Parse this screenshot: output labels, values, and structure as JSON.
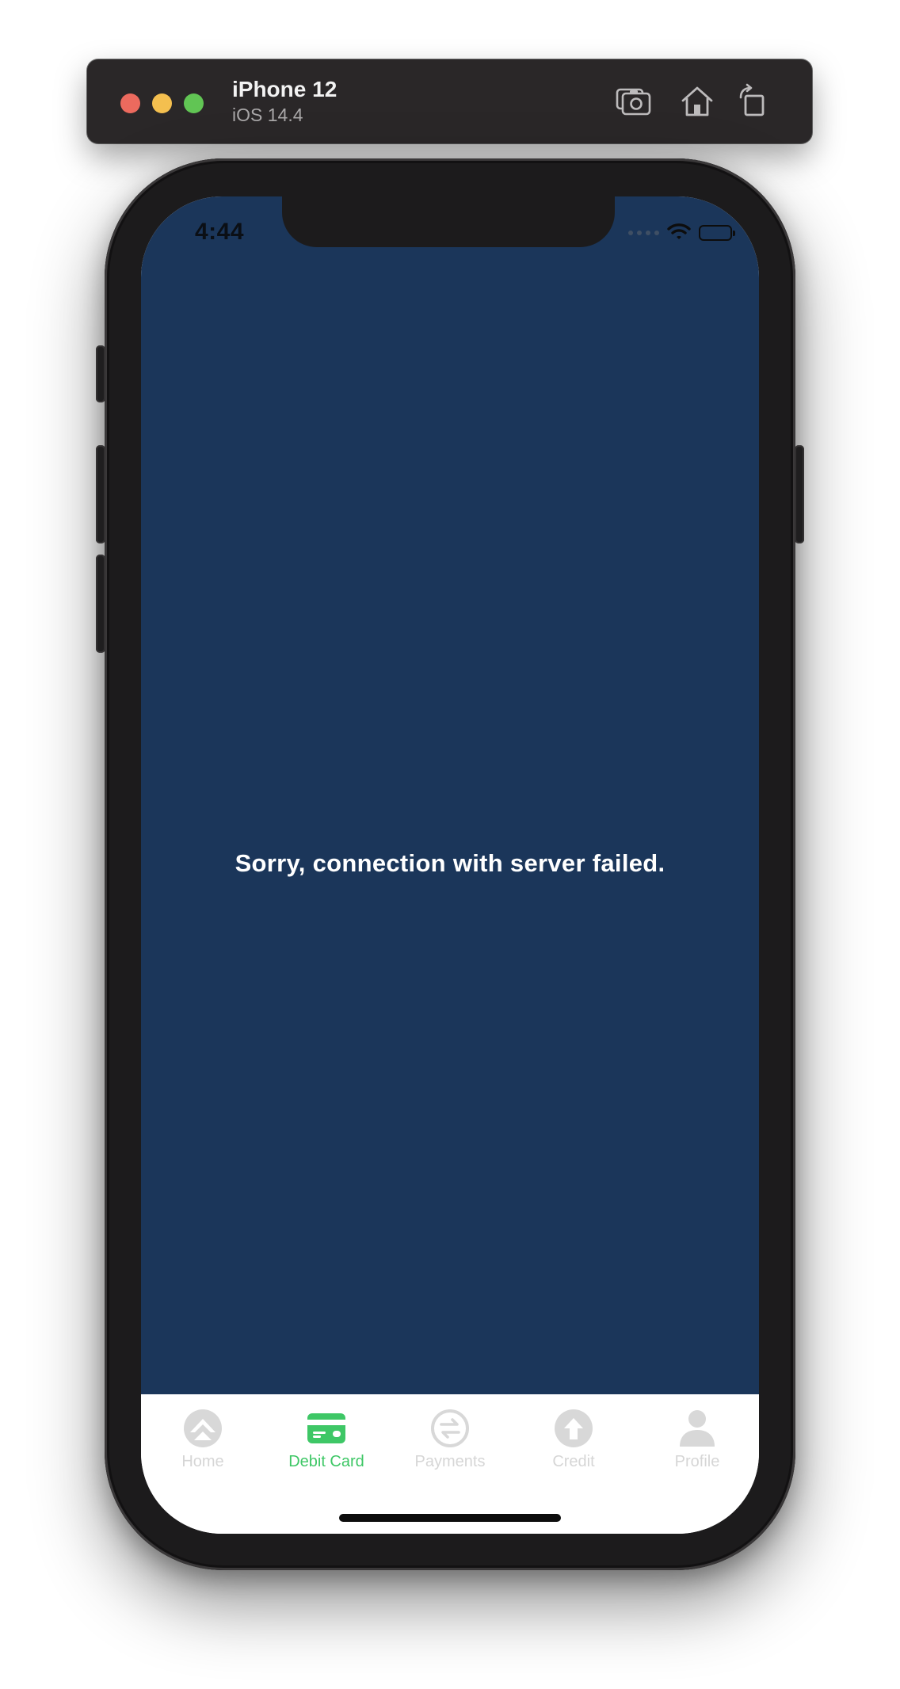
{
  "simulator": {
    "device_name": "iPhone 12",
    "os_version": "iOS 14.4",
    "toolbar": {
      "screenshot_icon": "camera-icon",
      "home_icon": "home-icon",
      "rotate_icon": "rotate-icon"
    }
  },
  "status_bar": {
    "time": "4:44"
  },
  "main": {
    "error_message": "Sorry, connection with server failed.",
    "background_color": "#1b365a"
  },
  "tab_bar": {
    "active_color": "#3ec766",
    "inactive_color": "#d6d6d6",
    "items": [
      {
        "label": "Home",
        "icon": "home-arrow-icon",
        "active": false
      },
      {
        "label": "Debit Card",
        "icon": "debit-card-icon",
        "active": true
      },
      {
        "label": "Payments",
        "icon": "payments-icon",
        "active": false
      },
      {
        "label": "Credit",
        "icon": "credit-icon",
        "active": false
      },
      {
        "label": "Profile",
        "icon": "profile-icon",
        "active": false
      }
    ]
  }
}
